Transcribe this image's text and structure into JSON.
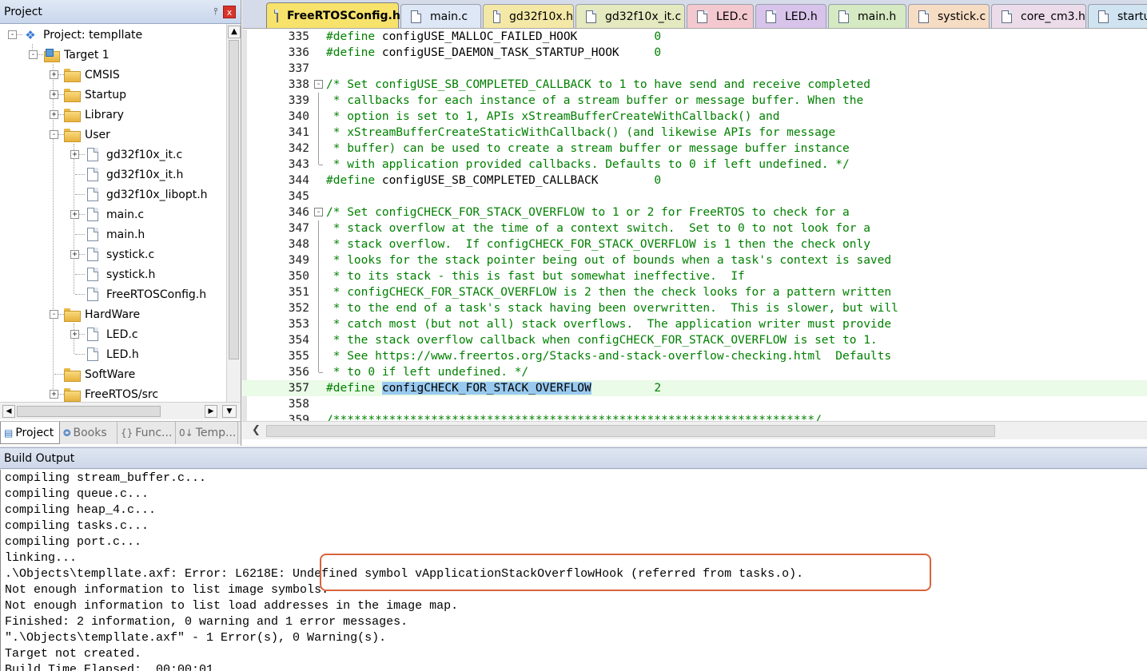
{
  "project_panel": {
    "title": "Project",
    "pin_icon": "pin-icon",
    "close_label": "x",
    "tree": [
      {
        "label": "Project: templlate",
        "type": "project",
        "expander": "-"
      },
      {
        "label": "Target 1",
        "type": "target",
        "expander": "-"
      },
      {
        "label": "CMSIS",
        "type": "folder",
        "expander": "+"
      },
      {
        "label": "Startup",
        "type": "folder",
        "expander": "+"
      },
      {
        "label": "Library",
        "type": "folder",
        "expander": "+"
      },
      {
        "label": "User",
        "type": "folder-open",
        "expander": "-"
      },
      {
        "label": "gd32f10x_it.c",
        "type": "file",
        "expander": "+"
      },
      {
        "label": "gd32f10x_it.h",
        "type": "file",
        "expander": ""
      },
      {
        "label": "gd32f10x_libopt.h",
        "type": "file",
        "expander": ""
      },
      {
        "label": "main.c",
        "type": "file",
        "expander": "+"
      },
      {
        "label": "main.h",
        "type": "file",
        "expander": ""
      },
      {
        "label": "systick.c",
        "type": "file",
        "expander": "+"
      },
      {
        "label": "systick.h",
        "type": "file",
        "expander": ""
      },
      {
        "label": "FreeRTOSConfig.h",
        "type": "file",
        "expander": ""
      },
      {
        "label": "HardWare",
        "type": "folder-open",
        "expander": "-"
      },
      {
        "label": "LED.c",
        "type": "file",
        "expander": "+"
      },
      {
        "label": "LED.h",
        "type": "file",
        "expander": ""
      },
      {
        "label": "SoftWare",
        "type": "folder",
        "expander": ""
      },
      {
        "label": "FreeRTOS/src",
        "type": "folder",
        "expander": "+"
      }
    ],
    "bottom_tabs": [
      {
        "label": "Project",
        "icon": "project-icon"
      },
      {
        "label": "Books",
        "icon": "books-icon"
      },
      {
        "label": "Func...",
        "icon": "functions-icon"
      },
      {
        "label": "Temp...",
        "icon": "templates-icon"
      }
    ]
  },
  "editor": {
    "tabs": [
      {
        "label": "FreeRTOSConfig.h",
        "color": "#f7e26b",
        "active": true
      },
      {
        "label": "main.c",
        "color": "#dde7f5"
      },
      {
        "label": "gd32f10x.h",
        "color": "#f4e8a6"
      },
      {
        "label": "gd32f10x_it.c",
        "color": "#e4e9bf"
      },
      {
        "label": "LED.c",
        "color": "#f3c9cf"
      },
      {
        "label": "LED.h",
        "color": "#d8c4ea"
      },
      {
        "label": "main.h",
        "color": "#d5e9c2"
      },
      {
        "label": "systick.c",
        "color": "#f7dcc4"
      },
      {
        "label": "core_cm3.h",
        "color": "#ecdcea"
      },
      {
        "label": "startu",
        "color": "#cfe3f0"
      }
    ],
    "lines": [
      {
        "n": "335",
        "pre": "#define ",
        "macro": "configUSE_MALLOC_FAILED_HOOK",
        "pad": "           ",
        "val": "0"
      },
      {
        "n": "336",
        "pre": "#define ",
        "macro": "configUSE_DAEMON_TASK_STARTUP_HOOK",
        "pad": "     ",
        "val": "0"
      },
      {
        "n": "337",
        "text": ""
      },
      {
        "n": "338",
        "text": "/* Set configUSE_SB_COMPLETED_CALLBACK to 1 to have send and receive completed",
        "fold": "start"
      },
      {
        "n": "339",
        "text": " * callbacks for each instance of a stream buffer or message buffer. When the",
        "fold": "mid"
      },
      {
        "n": "340",
        "text": " * option is set to 1, APIs xStreamBufferCreateWithCallback() and",
        "fold": "mid"
      },
      {
        "n": "341",
        "text": " * xStreamBufferCreateStaticWithCallback() (and likewise APIs for message",
        "fold": "mid"
      },
      {
        "n": "342",
        "text": " * buffer) can be used to create a stream buffer or message buffer instance",
        "fold": "mid"
      },
      {
        "n": "343",
        "text": " * with application provided callbacks. Defaults to 0 if left undefined. */",
        "fold": "end"
      },
      {
        "n": "344",
        "pre": "#define ",
        "macro": "configUSE_SB_COMPLETED_CALLBACK",
        "pad": "        ",
        "val": "0"
      },
      {
        "n": "345",
        "text": ""
      },
      {
        "n": "346",
        "text": "/* Set configCHECK_FOR_STACK_OVERFLOW to 1 or 2 for FreeRTOS to check for a",
        "fold": "start"
      },
      {
        "n": "347",
        "text": " * stack overflow at the time of a context switch.  Set to 0 to not look for a",
        "fold": "mid"
      },
      {
        "n": "348",
        "text": " * stack overflow.  If configCHECK_FOR_STACK_OVERFLOW is 1 then the check only",
        "fold": "mid"
      },
      {
        "n": "349",
        "text": " * looks for the stack pointer being out of bounds when a task's context is saved",
        "fold": "mid"
      },
      {
        "n": "350",
        "text": " * to its stack - this is fast but somewhat ineffective.  If",
        "fold": "mid"
      },
      {
        "n": "351",
        "text": " * configCHECK_FOR_STACK_OVERFLOW is 2 then the check looks for a pattern written",
        "fold": "mid"
      },
      {
        "n": "352",
        "text": " * to the end of a task's stack having been overwritten.  This is slower, but will",
        "fold": "mid"
      },
      {
        "n": "353",
        "text": " * catch most (but not all) stack overflows.  The application writer must provide",
        "fold": "mid"
      },
      {
        "n": "354",
        "text": " * the stack overflow callback when configCHECK_FOR_STACK_OVERFLOW is set to 1.",
        "fold": "mid"
      },
      {
        "n": "355",
        "text": " * See https://www.freertos.org/Stacks-and-stack-overflow-checking.html  Defaults",
        "fold": "mid"
      },
      {
        "n": "356",
        "text": " * to 0 if left undefined. */",
        "fold": "end"
      },
      {
        "n": "357",
        "pre": "#define ",
        "macro": "configCHECK_FOR_STACK_OVERFLOW",
        "pad": "         ",
        "val": "2",
        "selected": true,
        "highlight": true
      },
      {
        "n": "358",
        "text": ""
      },
      {
        "n": "359",
        "text": "/*********************************************************************/"
      }
    ],
    "colors": {
      "comment": "#008000",
      "selection": "#99c9ef",
      "current_line": "#eafbe8"
    }
  },
  "build_output": {
    "title": "Build Output",
    "lines": [
      "compiling stream_buffer.c...",
      "compiling queue.c...",
      "compiling heap_4.c...",
      "compiling tasks.c...",
      "compiling port.c...",
      "linking...",
      ".\\Objects\\templlate.axf: Error: L6218E: Undefined symbol vApplicationStackOverflowHook (referred from tasks.o).",
      "Not enough information to list image symbols.",
      "Not enough information to list load addresses in the image map.",
      "Finished: 2 information, 0 warning and 1 error messages.",
      "\".\\Objects\\templlate.axf\" - 1 Error(s), 0 Warning(s).",
      "Target not created.",
      "Build Time Elapsed:  00:00:01"
    ],
    "highlight_color": "#d9633b"
  }
}
